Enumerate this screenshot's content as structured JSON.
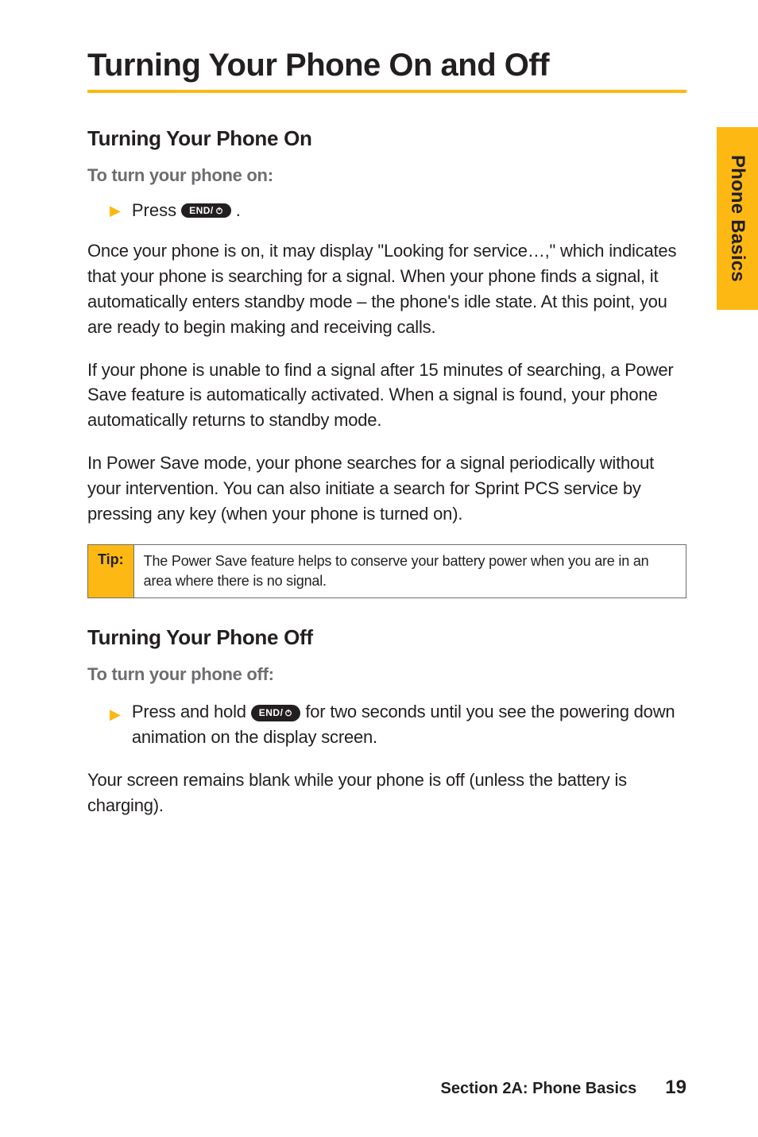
{
  "title": "Turning Your Phone On and Off",
  "side_tab": "Phone Basics",
  "section_on": {
    "heading": "Turning Your Phone On",
    "lead": "To turn your phone on:",
    "bullet_prefix": "Press",
    "bullet_suffix": ".",
    "endkey_label": "END/",
    "paras": [
      "Once your phone is on, it may display \"Looking for service…,\" which indicates that your phone is searching for a signal. When your phone finds a signal, it automatically enters standby mode – the phone's idle state. At this point, you are ready to begin making and receiving calls.",
      "If your phone is unable to find a signal after 15 minutes of searching, a Power Save feature is automatically activated. When a signal is found, your phone automatically returns to standby mode.",
      "In Power Save mode, your phone searches for a signal periodically without your intervention. You can also initiate a search for Sprint PCS service by pressing any key (when your phone is turned on)."
    ]
  },
  "tip": {
    "label": "Tip:",
    "body": "The Power Save feature helps to conserve your battery power when you are in an area where there is no signal."
  },
  "section_off": {
    "heading": "Turning Your Phone Off",
    "lead": "To turn your phone off:",
    "bullet_pre": "Press and hold",
    "bullet_post": "for two seconds until you see the powering down animation on the display screen.",
    "endkey_label": "END/",
    "para": "Your screen remains blank while your phone is off (unless the battery is charging)."
  },
  "footer": {
    "section": "Section 2A: Phone Basics",
    "page": "19"
  }
}
